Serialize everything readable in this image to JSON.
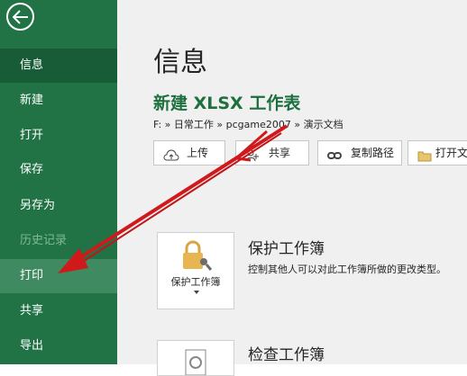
{
  "sidebar": {
    "items": [
      {
        "label": "信息"
      },
      {
        "label": "新建"
      },
      {
        "label": "打开"
      },
      {
        "label": "保存"
      },
      {
        "label": "另存为"
      },
      {
        "label": "历史记录"
      },
      {
        "label": "打印"
      },
      {
        "label": "共享"
      },
      {
        "label": "导出"
      }
    ]
  },
  "main": {
    "page_title": "信息",
    "doc_title": "新建 XLSX 工作表",
    "path": "F: » 日常工作 » pcgame2007 » 演示文档",
    "buttons": [
      {
        "label": "上传",
        "icon": "upload-cloud-icon"
      },
      {
        "label": "共享",
        "icon": "share-person-icon"
      },
      {
        "label": "复制路径",
        "icon": "link-icon"
      },
      {
        "label": "打开文件位置",
        "icon": "folder-icon"
      }
    ],
    "protect": {
      "tile_label": "保护工作簿",
      "title": "保护工作簿",
      "desc": "控制其他人可以对此工作簿所做的更改类型。"
    },
    "inspect": {
      "title": "检查工作簿"
    }
  },
  "colors": {
    "sidebar_bg": "#217346",
    "accent_green": "#1e6f3e",
    "annotation_red": "#d0191a"
  }
}
